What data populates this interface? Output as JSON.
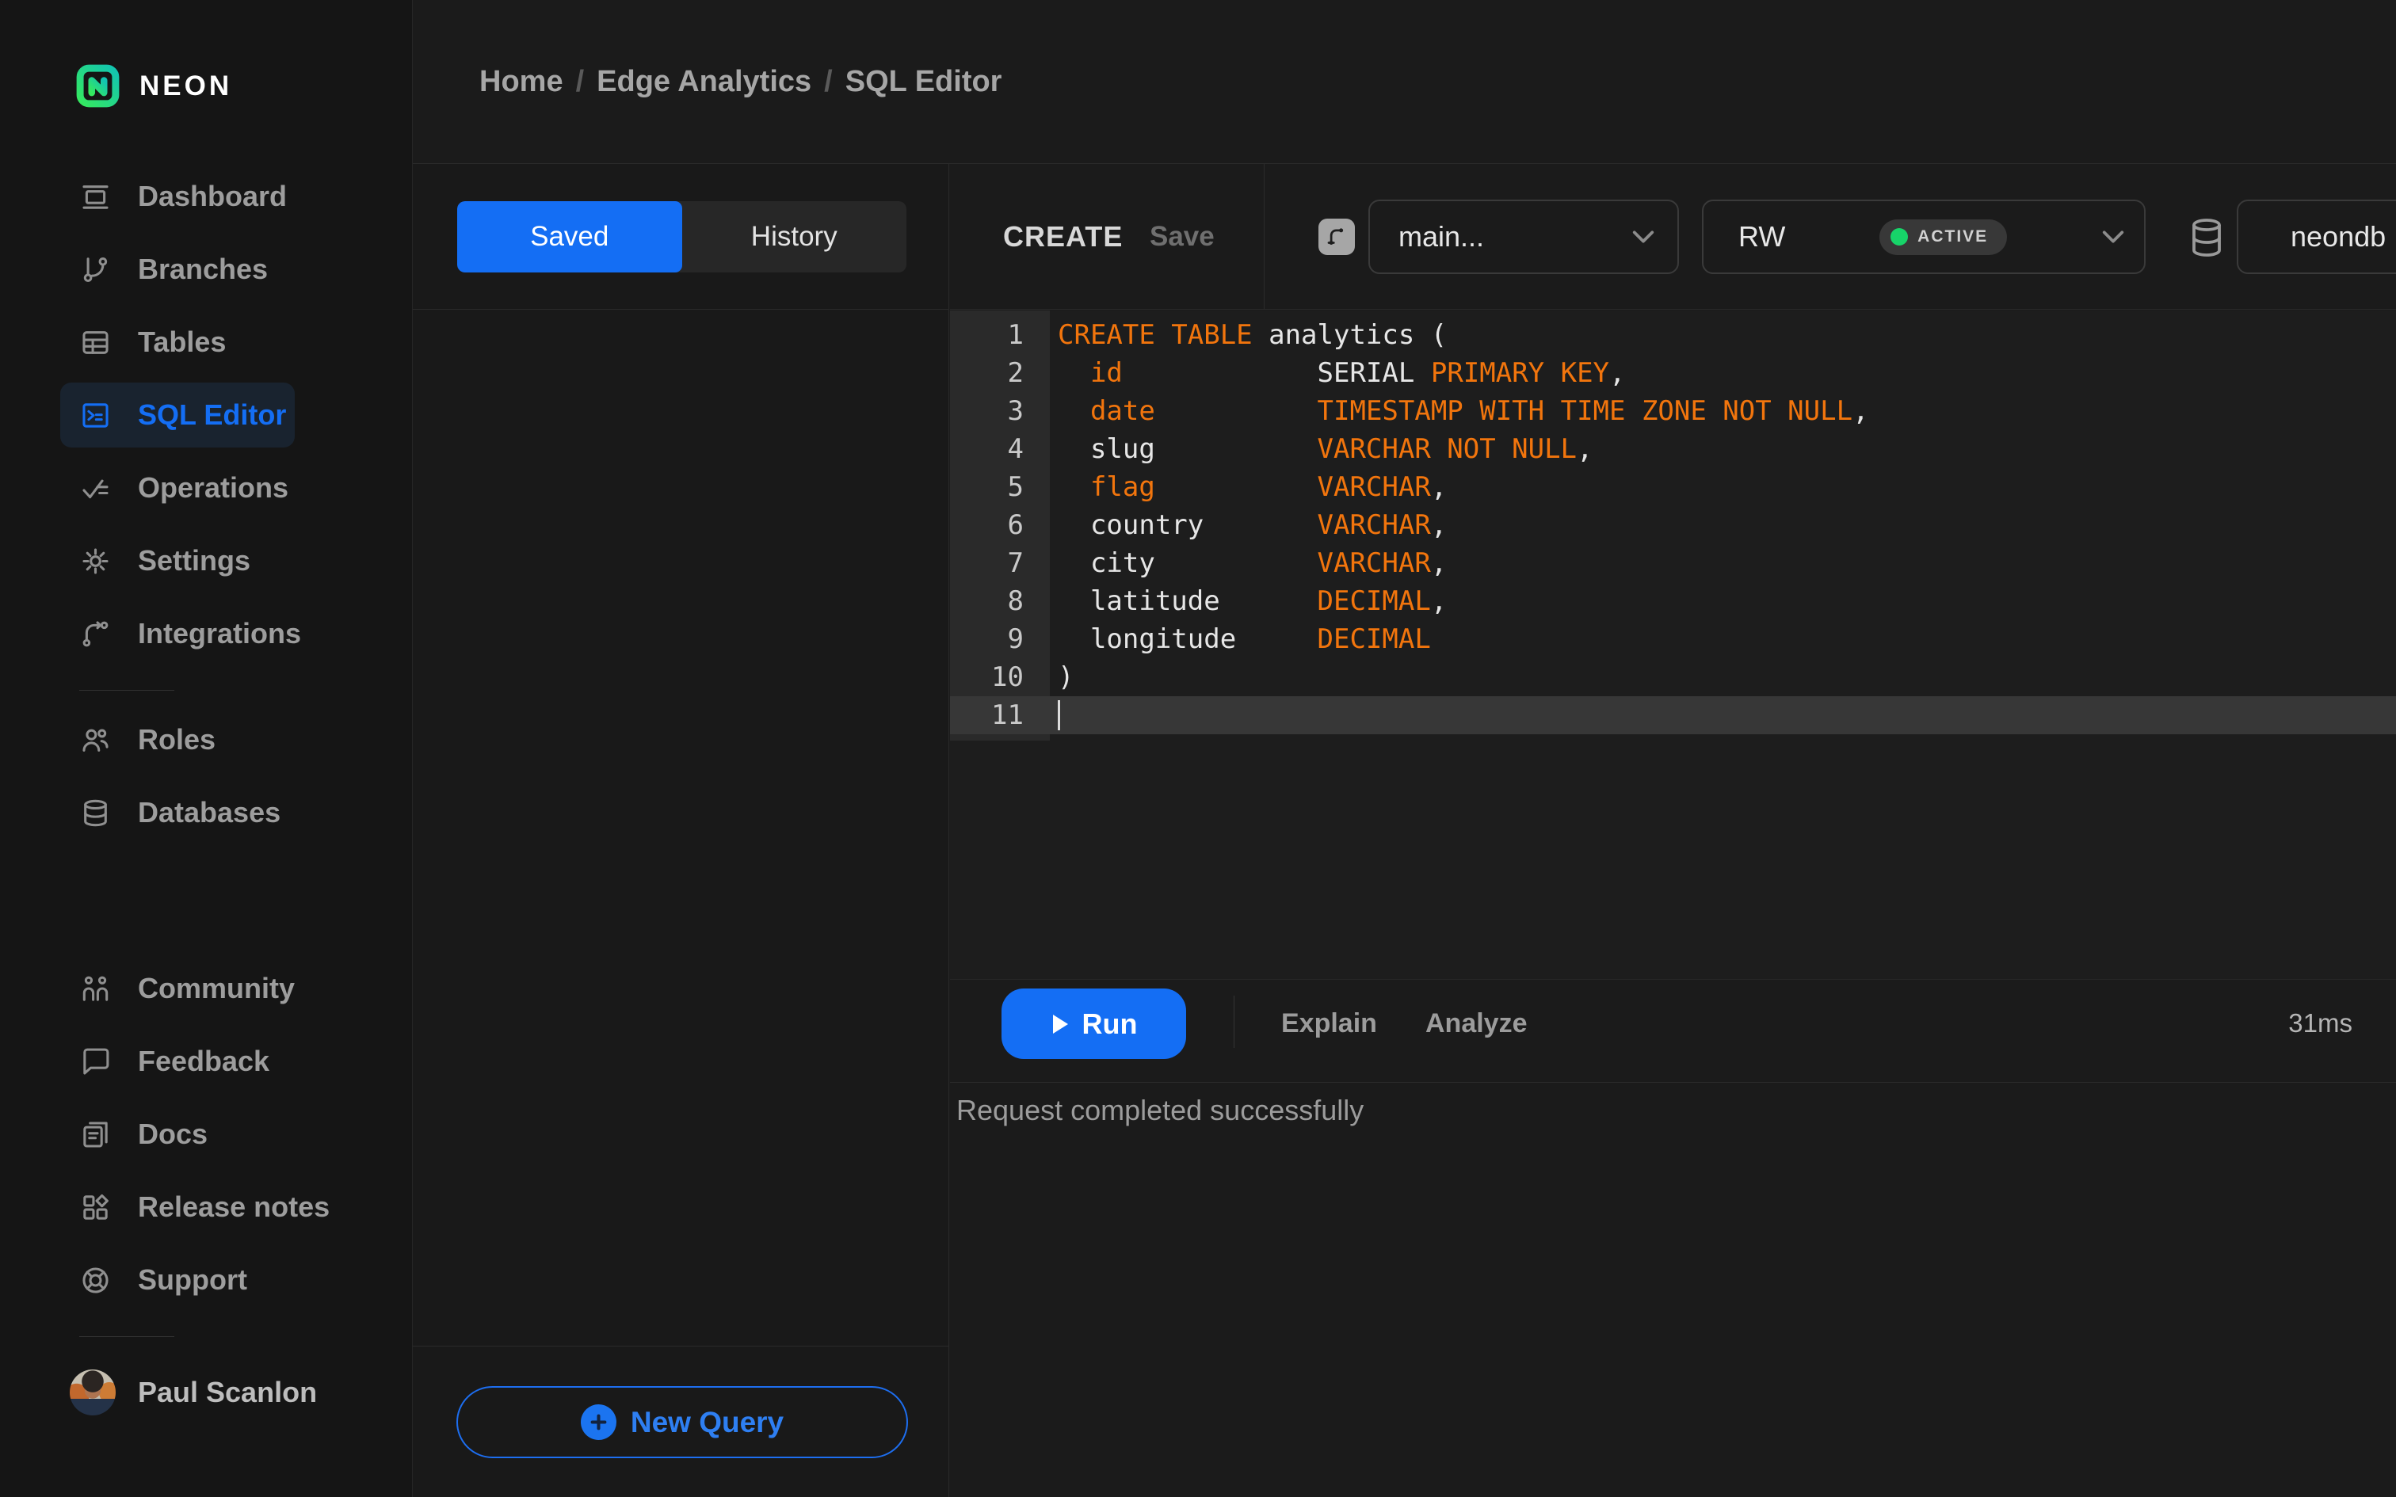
{
  "colors": {
    "accent-blue": "#146ef4",
    "brand-green": "#00e599",
    "keyword-orange": "#f2750d",
    "status-green": "#17d469"
  },
  "brand": {
    "name": "NEON"
  },
  "breadcrumb": {
    "separator": "/",
    "items": [
      "Home",
      "Edge Analytics",
      "SQL Editor"
    ]
  },
  "sidebar": {
    "main_items": [
      {
        "label": "Dashboard",
        "icon": "dashboard-icon",
        "selected": false
      },
      {
        "label": "Branches",
        "icon": "branches-icon",
        "selected": false
      },
      {
        "label": "Tables",
        "icon": "tables-icon",
        "selected": false
      },
      {
        "label": "SQL Editor",
        "icon": "sql-editor-icon",
        "selected": true
      },
      {
        "label": "Operations",
        "icon": "operations-icon",
        "selected": false
      },
      {
        "label": "Settings",
        "icon": "settings-icon",
        "selected": false
      },
      {
        "label": "Integrations",
        "icon": "integrations-icon",
        "selected": false
      }
    ],
    "secondary_items": [
      {
        "label": "Roles",
        "icon": "roles-icon",
        "selected": false
      },
      {
        "label": "Databases",
        "icon": "databases-icon",
        "selected": false
      }
    ],
    "footer_items": [
      {
        "label": "Community",
        "icon": "community-icon",
        "selected": false
      },
      {
        "label": "Feedback",
        "icon": "feedback-icon",
        "selected": false
      },
      {
        "label": "Docs",
        "icon": "docs-icon",
        "selected": false
      },
      {
        "label": "Release notes",
        "icon": "release-notes-icon",
        "selected": false
      },
      {
        "label": "Support",
        "icon": "support-icon",
        "selected": false
      }
    ],
    "user": {
      "name": "Paul Scanlon"
    }
  },
  "queries_panel": {
    "tabs": [
      {
        "label": "Saved",
        "selected": true
      },
      {
        "label": "History",
        "selected": false
      }
    ],
    "new_query": {
      "label": "New Query",
      "icon": "plus-circle-icon"
    }
  },
  "editor": {
    "query_title": "CREATE",
    "save_label": "Save",
    "branch": {
      "value": "main...",
      "icon": "branch-merge-icon"
    },
    "compute": {
      "value": "RW",
      "status": "ACTIVE"
    },
    "database": {
      "value": "neondb",
      "icon": "database-icon"
    },
    "code": {
      "lines": [
        {
          "num": 1,
          "active": false,
          "segments": [
            {
              "text": "CREATE TABLE",
              "style": "keyword"
            },
            {
              "text": " analytics (",
              "style": "plain"
            }
          ]
        },
        {
          "num": 2,
          "active": false,
          "segments": [
            {
              "text": "  ",
              "style": "plain"
            },
            {
              "text": "id",
              "style": "keyword"
            },
            {
              "text": "            SERIAL ",
              "style": "plain"
            },
            {
              "text": "PRIMARY KEY",
              "style": "keyword"
            },
            {
              "text": ",",
              "style": "plain"
            }
          ]
        },
        {
          "num": 3,
          "active": false,
          "segments": [
            {
              "text": "  ",
              "style": "plain"
            },
            {
              "text": "date",
              "style": "keyword"
            },
            {
              "text": "          ",
              "style": "plain"
            },
            {
              "text": "TIMESTAMP WITH TIME ZONE NOT NULL",
              "style": "keyword"
            },
            {
              "text": ",",
              "style": "plain"
            }
          ]
        },
        {
          "num": 4,
          "active": false,
          "segments": [
            {
              "text": "  slug          ",
              "style": "plain"
            },
            {
              "text": "VARCHAR NOT NULL",
              "style": "keyword"
            },
            {
              "text": ",",
              "style": "plain"
            }
          ]
        },
        {
          "num": 5,
          "active": false,
          "segments": [
            {
              "text": "  ",
              "style": "plain"
            },
            {
              "text": "flag",
              "style": "keyword"
            },
            {
              "text": "          ",
              "style": "plain"
            },
            {
              "text": "VARCHAR",
              "style": "keyword"
            },
            {
              "text": ",",
              "style": "plain"
            }
          ]
        },
        {
          "num": 6,
          "active": false,
          "segments": [
            {
              "text": "  country       ",
              "style": "plain"
            },
            {
              "text": "VARCHAR",
              "style": "keyword"
            },
            {
              "text": ",",
              "style": "plain"
            }
          ]
        },
        {
          "num": 7,
          "active": false,
          "segments": [
            {
              "text": "  city          ",
              "style": "plain"
            },
            {
              "text": "VARCHAR",
              "style": "keyword"
            },
            {
              "text": ",",
              "style": "plain"
            }
          ]
        },
        {
          "num": 8,
          "active": false,
          "segments": [
            {
              "text": "  latitude      ",
              "style": "plain"
            },
            {
              "text": "DECIMAL",
              "style": "keyword"
            },
            {
              "text": ",",
              "style": "plain"
            }
          ]
        },
        {
          "num": 9,
          "active": false,
          "segments": [
            {
              "text": "  longitude     ",
              "style": "plain"
            },
            {
              "text": "DECIMAL",
              "style": "keyword"
            }
          ]
        },
        {
          "num": 10,
          "active": false,
          "segments": [
            {
              "text": ")",
              "style": "plain"
            }
          ]
        },
        {
          "num": 11,
          "active": true,
          "cursor": true,
          "segments": []
        }
      ]
    },
    "actions": {
      "run": "Run",
      "explain": "Explain",
      "analyze": "Analyze",
      "duration": "31ms"
    },
    "status_message": "Request completed successfully"
  }
}
